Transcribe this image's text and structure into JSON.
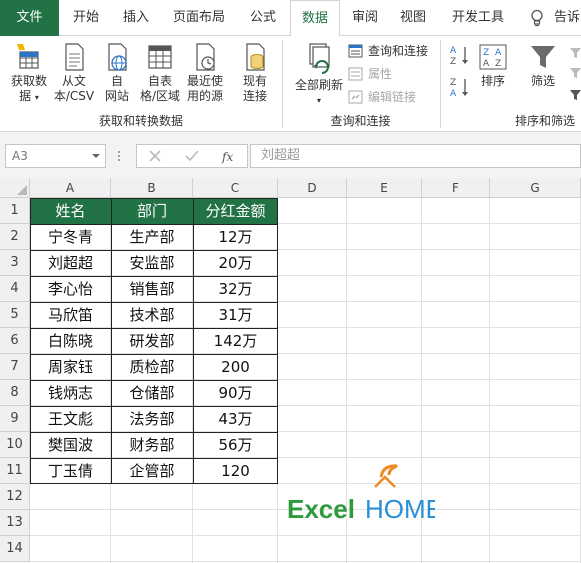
{
  "tabs": {
    "file": "文件",
    "home": "开始",
    "insert": "插入",
    "page_layout": "页面布局",
    "formulas": "公式",
    "data": "数据",
    "review": "审阅",
    "view": "视图",
    "developer": "开发工具",
    "tell_me": "告诉"
  },
  "ribbon": {
    "get_data_l1": "获取数",
    "get_data_l2": "据",
    "from_text_l1": "从文",
    "from_text_l2": "本/CSV",
    "from_web_l1": "自",
    "from_web_l2": "网站",
    "from_table_l1": "自表",
    "from_table_l2": "格/区域",
    "recent_l1": "最近使",
    "recent_l2": "用的源",
    "existing_l1": "现有",
    "existing_l2": "连接",
    "group_get": "获取和转换数据",
    "refresh_all": "全部刷新",
    "queries_connections": "查询和连接",
    "properties": "属性",
    "edit_links": "编辑链接",
    "group_query": "查询和连接",
    "sort": "排序",
    "filter": "筛选",
    "group_sort": "排序和筛选"
  },
  "formula_bar": {
    "name_box": "A3",
    "formula": "刘超超"
  },
  "columns": [
    "A",
    "B",
    "C",
    "D",
    "E",
    "F",
    "G"
  ],
  "rows": [
    "1",
    "2",
    "3",
    "4",
    "5",
    "6",
    "7",
    "8",
    "9",
    "10",
    "11",
    "12",
    "13",
    "14"
  ],
  "table": {
    "headers": [
      "姓名",
      "部门",
      "分红金额"
    ],
    "rows": [
      [
        "宁冬青",
        "生产部",
        "12万"
      ],
      [
        "刘超超",
        "安监部",
        "20万"
      ],
      [
        "李心怡",
        "销售部",
        "32万"
      ],
      [
        "马欣笛",
        "技术部",
        "31万"
      ],
      [
        "白陈晓",
        "研发部",
        "142万"
      ],
      [
        "周家钰",
        "质检部",
        "200"
      ],
      [
        "钱炳志",
        "仓储部",
        "90万"
      ],
      [
        "王文彪",
        "法务部",
        "43万"
      ],
      [
        "樊国波",
        "财务部",
        "56万"
      ],
      [
        "丁玉倩",
        "企管部",
        "120"
      ]
    ]
  },
  "logo": {
    "text_excel": "Excel",
    "text_home": "HOME"
  },
  "colors": {
    "excel_green": "#217346",
    "logo_green": "#2e9a3e",
    "logo_blue": "#2a8fd6",
    "logo_orange": "#f08a24"
  }
}
